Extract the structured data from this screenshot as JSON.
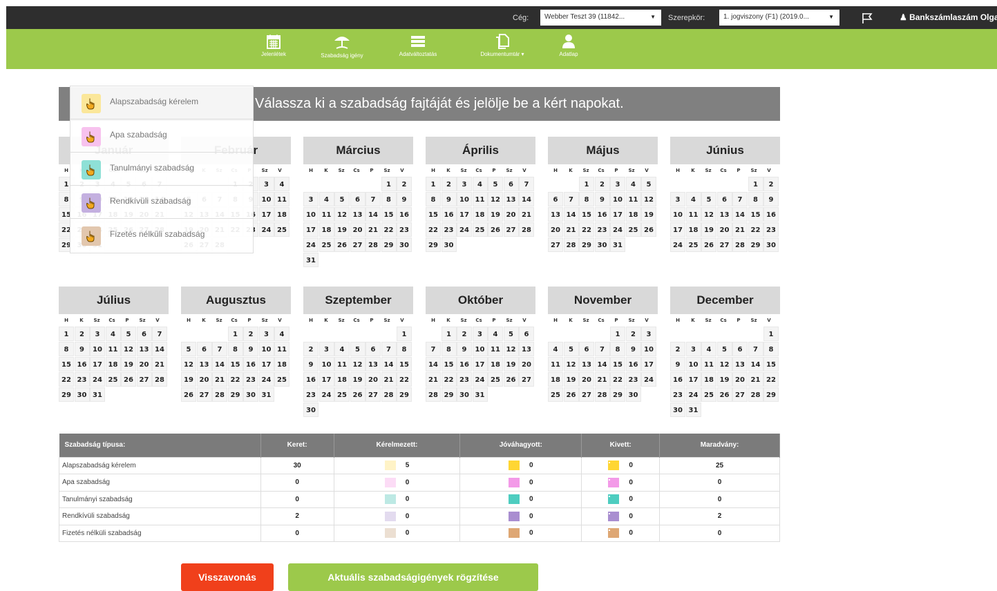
{
  "topbar": {
    "company_label": "Cég:",
    "company_value": "Webber Teszt 39 (11842...",
    "role_label": "Szerepkör:",
    "role_value": "1. jogviszony (F1) (2019.0...",
    "user_name": "Bankszámlaszám Olga ("
  },
  "nav": [
    {
      "label": "Jelenlétek",
      "icon": "calendar-icon"
    },
    {
      "label": "Szabadság igény",
      "icon": "beach-umbrella-icon"
    },
    {
      "label": "Adatváltoztatás",
      "icon": "list-icon"
    },
    {
      "label": "Dokumentumtár",
      "icon": "document-icon"
    },
    {
      "label": "Adatlap",
      "icon": "user-icon"
    }
  ],
  "banner_text": "Válassza ki a szabadság fajtáját és jelölje be a kért napokat.",
  "weekdays": [
    "H",
    "K",
    "Sz",
    "Cs",
    "P",
    "Sz",
    "V"
  ],
  "months": [
    {
      "name": "Január",
      "offset": 0,
      "days": 31
    },
    {
      "name": "Február",
      "offset": 3,
      "days": 28
    },
    {
      "name": "Március",
      "offset": 5,
      "days": 31
    },
    {
      "name": "Április",
      "offset": 0,
      "days": 30
    },
    {
      "name": "Május",
      "offset": 2,
      "days": 31
    },
    {
      "name": "Június",
      "offset": 5,
      "days": 30
    },
    {
      "name": "Július",
      "offset": 0,
      "days": 31
    },
    {
      "name": "Augusztus",
      "offset": 3,
      "days": 31
    },
    {
      "name": "Szeptember",
      "offset": 6,
      "days": 30
    },
    {
      "name": "Október",
      "offset": 1,
      "days": 31
    },
    {
      "name": "November",
      "offset": 4,
      "days": 30
    },
    {
      "name": "December",
      "offset": 6,
      "days": 31
    }
  ],
  "leave_types": [
    {
      "label": "Alapszabadság kérelem",
      "color": "#fbe79a"
    },
    {
      "label": "Apa szabadság",
      "color": "#f7c2ee"
    },
    {
      "label": "Tanulmányi szabadság",
      "color": "#8ee0d6"
    },
    {
      "label": "Rendkívüli szabadság",
      "color": "#c4b0e0"
    },
    {
      "label": "Fizetés nélküli szabadság",
      "color": "#e2c7ae"
    }
  ],
  "summary": {
    "headers": [
      "Szabadság típusa:",
      "Keret:",
      "Kérelmezett:",
      "Jóváhagyott:",
      "Kivett:",
      "Maradvány:"
    ],
    "rows": [
      {
        "type": "Alapszabadság kérelem",
        "keret": "30",
        "kerelmezett": "5",
        "jovahagyott": "0",
        "kivett": "0",
        "maradvany": "25",
        "c1": "#fff3c7",
        "c2": "#ffd633",
        "c3": "#ffd633"
      },
      {
        "type": "Apa szabadság",
        "keret": "0",
        "kerelmezett": "0",
        "jovahagyott": "0",
        "kivett": "0",
        "maradvany": "0",
        "c1": "#fcdcf6",
        "c2": "#f39ae8",
        "c3": "#f39ae8"
      },
      {
        "type": "Tanulmányi szabadság",
        "keret": "0",
        "kerelmezett": "0",
        "jovahagyott": "0",
        "kivett": "0",
        "maradvany": "0",
        "c1": "#bde9e4",
        "c2": "#4ecdc0",
        "c3": "#4ecdc0"
      },
      {
        "type": "Rendkívüli szabadság",
        "keret": "2",
        "kerelmezett": "0",
        "jovahagyott": "0",
        "kivett": "0",
        "maradvany": "2",
        "c1": "#e3dbef",
        "c2": "#a98ed0",
        "c3": "#a98ed0"
      },
      {
        "type": "Fizetés nélküli szabadság",
        "keret": "0",
        "kerelmezett": "0",
        "jovahagyott": "0",
        "kivett": "0",
        "maradvany": "0",
        "c1": "#ecdfd2",
        "c2": "#dea774",
        "c3": "#dea774"
      }
    ]
  },
  "buttons": {
    "cancel": "Visszavonás",
    "save": "Aktuális szabadságigények rögzítése"
  },
  "colors": {
    "green": "#9cc94b",
    "red": "#f0401b",
    "dark": "#2e2e2e"
  }
}
